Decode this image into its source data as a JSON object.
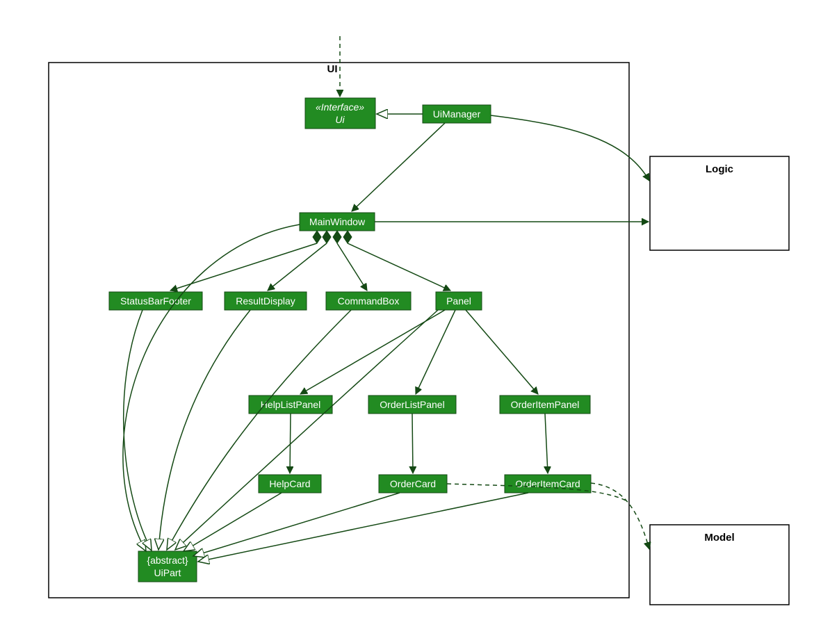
{
  "packages": {
    "ui": "UI",
    "logic": "Logic",
    "model": "Model"
  },
  "nodes": {
    "ui_iface": {
      "stereo": "«Interface»",
      "name": "Ui"
    },
    "uimanager": "UiManager",
    "mainwindow": "MainWindow",
    "statusbar": "StatusBarFooter",
    "resultdisplay": "ResultDisplay",
    "commandbox": "CommandBox",
    "panel": "Panel",
    "helplistpanel": "HelpListPanel",
    "orderlistpanel": "OrderListPanel",
    "orderitempanel": "OrderItemPanel",
    "helpcard": "HelpCard",
    "ordercard": "OrderCard",
    "orderitemcard": "OrderItemCard",
    "uipart": {
      "stereo": "{abstract}",
      "name": "UiPart"
    }
  }
}
